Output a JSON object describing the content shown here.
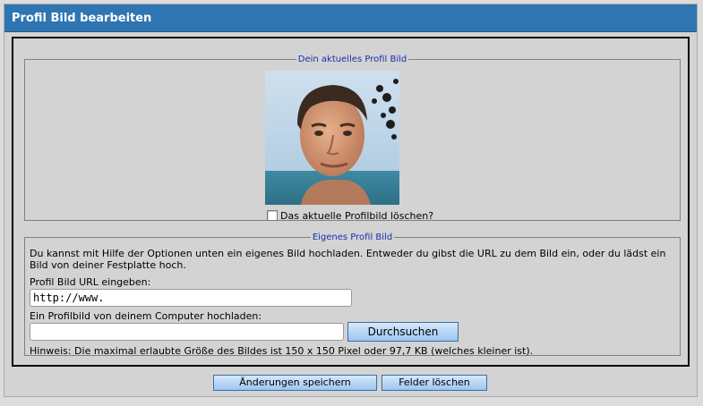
{
  "header": {
    "title": "Profil Bild bearbeiten"
  },
  "current": {
    "legend": "Dein aktuelles Profil Bild",
    "delete_label": "Das aktuelle Profilbild löschen?"
  },
  "own": {
    "legend": "Eigenes Profil Bild",
    "description": "Du kannst mit Hilfe der Optionen unten ein eigenes Bild hochladen. Entweder du gibst die URL zu dem Bild ein, oder du lädst ein Bild von deiner Festplatte hoch.",
    "url_label": "Profil Bild URL eingeben:",
    "url_value": "http://www.",
    "upload_label": "Ein Profilbild von deinem Computer hochladen:",
    "browse_label": "Durchsuchen",
    "hint": "Hinweis: Die maximal erlaubte Größe des Bildes ist 150 x 150 Pixel oder 97,7 KB (welches kleiner ist)."
  },
  "actions": {
    "save_label": "Änderungen speichern",
    "clear_label": "Felder löschen"
  },
  "colors": {
    "header_bg": "#2f75b1",
    "legend_text": "#1a2db0",
    "button_gradient_top": "#d6e8fb",
    "button_gradient_bottom": "#9cc6f0"
  }
}
